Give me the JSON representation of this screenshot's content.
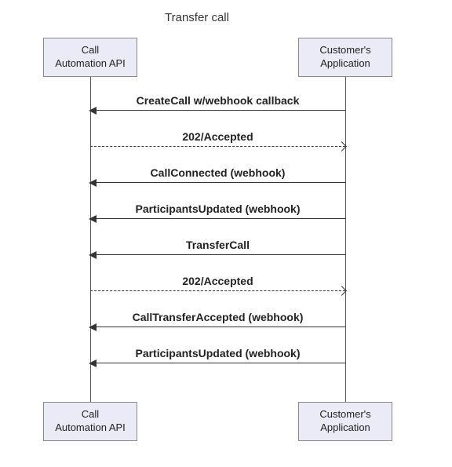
{
  "title": "Transfer call",
  "participants": {
    "left": "Call\nAutomation API",
    "right": "Customer's\nApplication"
  },
  "messages": [
    {
      "label": "CreateCall w/webhook callback",
      "direction": "left",
      "style": "solid"
    },
    {
      "label": "202/Accepted",
      "direction": "right",
      "style": "dashed"
    },
    {
      "label": "CallConnected (webhook)",
      "direction": "left",
      "style": "solid"
    },
    {
      "label": "ParticipantsUpdated (webhook)",
      "direction": "left",
      "style": "solid"
    },
    {
      "label": "TransferCall",
      "direction": "left",
      "style": "solid"
    },
    {
      "label": "202/Accepted",
      "direction": "right",
      "style": "dashed"
    },
    {
      "label": "CallTransferAccepted (webhook)",
      "direction": "left",
      "style": "solid"
    },
    {
      "label": "ParticipantsUpdated (webhook)",
      "direction": "left",
      "style": "solid"
    }
  ],
  "chart_data": {
    "type": "sequence",
    "title": "Transfer call",
    "actors": [
      "Call Automation API",
      "Customer's Application"
    ],
    "messages": [
      {
        "from": "Customer's Application",
        "to": "Call Automation API",
        "text": "CreateCall w/webhook callback",
        "kind": "sync"
      },
      {
        "from": "Call Automation API",
        "to": "Customer's Application",
        "text": "202/Accepted",
        "kind": "return"
      },
      {
        "from": "Customer's Application",
        "to": "Call Automation API",
        "text": "CallConnected (webhook)",
        "kind": "sync"
      },
      {
        "from": "Customer's Application",
        "to": "Call Automation API",
        "text": "ParticipantsUpdated (webhook)",
        "kind": "sync"
      },
      {
        "from": "Customer's Application",
        "to": "Call Automation API",
        "text": "TransferCall",
        "kind": "sync"
      },
      {
        "from": "Call Automation API",
        "to": "Customer's Application",
        "text": "202/Accepted",
        "kind": "return"
      },
      {
        "from": "Customer's Application",
        "to": "Call Automation API",
        "text": "CallTransferAccepted (webhook)",
        "kind": "sync"
      },
      {
        "from": "Customer's Application",
        "to": "Call Automation API",
        "text": "ParticipantsUpdated (webhook)",
        "kind": "sync"
      }
    ]
  }
}
